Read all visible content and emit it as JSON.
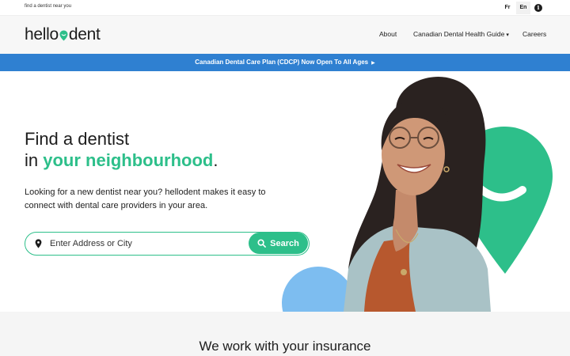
{
  "topbar": {
    "tagline": "find a dentist near you",
    "lang_fr": "Fr",
    "lang_en": "En",
    "info_icon": "info-icon"
  },
  "header": {
    "logo_left": "hello",
    "logo_right": "dent",
    "nav": {
      "about": "About",
      "guide": "Canadian Dental Health Guide",
      "careers": "Careers"
    }
  },
  "banner": {
    "text": "Canadian Dental Care Plan (CDCP) Now Open To All Ages"
  },
  "hero": {
    "heading_line1": "Find a dentist",
    "heading_line2_prefix": "in ",
    "heading_line2_highlight": "your neighbourhood",
    "heading_line2_suffix": ".",
    "lead": "Looking for a new dentist near you? hellodent makes it easy to connect with dental care providers in your area.",
    "search_placeholder": "Enter Address or City",
    "search_button": "Search"
  },
  "insurance": {
    "heading": "We work with your insurance"
  },
  "colors": {
    "brand_green": "#2dbf8a",
    "banner_blue": "#2f80d1",
    "circle_blue": "#7dbdf0"
  }
}
